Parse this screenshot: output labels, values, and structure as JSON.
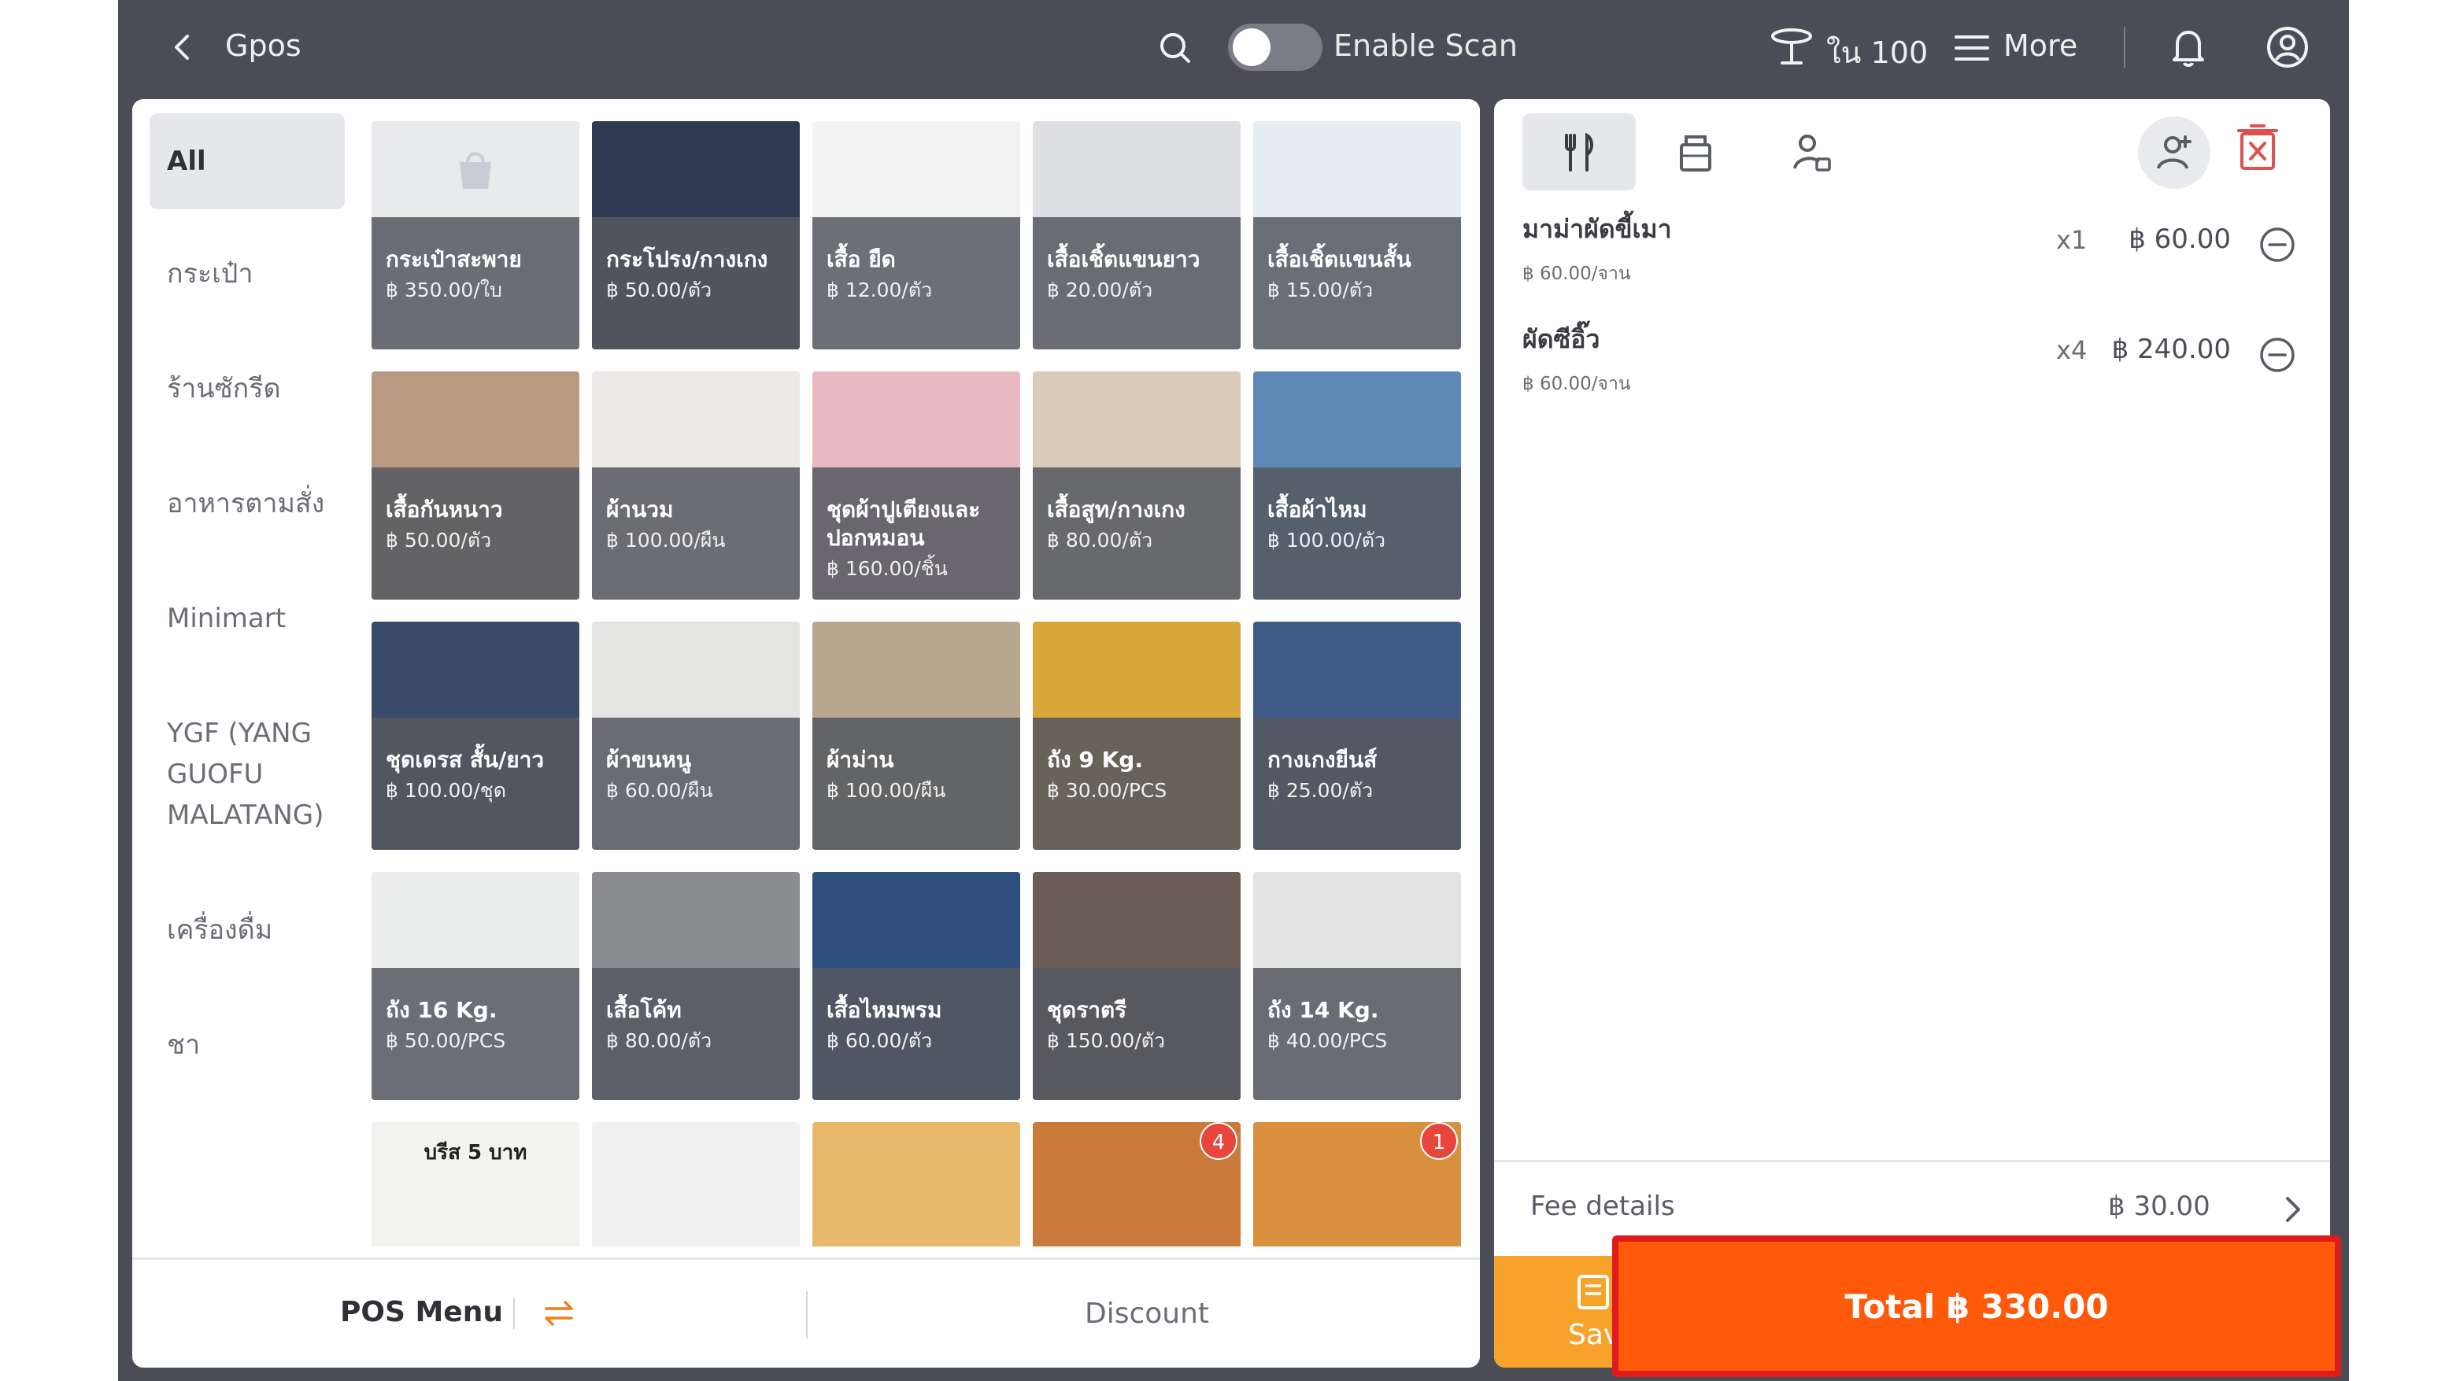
{
  "header": {
    "title": "Gpos",
    "scan_label": "Enable Scan",
    "scan_enabled": false,
    "table_label": "ใน 100",
    "more_label": "More"
  },
  "categories": [
    {
      "label": "All",
      "active": true
    },
    {
      "label": "กระเป๋า"
    },
    {
      "label": "ร้านซักรีด"
    },
    {
      "label": "อาหารตามสั่ง"
    },
    {
      "label": "Minimart"
    },
    {
      "label": "YGF (YANG GUOFU MALATANG)"
    },
    {
      "label": "เครื่องดื่ม"
    },
    {
      "label": "ชา"
    }
  ],
  "products": [
    {
      "name": "กระเป๋าสะพาย",
      "price": "฿ 350.00/ใบ",
      "bg": "#e9eaec"
    },
    {
      "name": "กระโปรง/กางเกง",
      "price": "฿ 50.00/ตัว",
      "bg": "#2f3a52"
    },
    {
      "name": "เสื้อ ยืด",
      "price": "฿ 12.00/ตัว",
      "bg": "#f3f3f3"
    },
    {
      "name": "เสื้อเชิ้ตแขนยาว",
      "price": "฿ 20.00/ตัว",
      "bg": "#dedfe2"
    },
    {
      "name": "เสื้อเชิ้ตแขนสั้น",
      "price": "฿ 15.00/ตัว",
      "bg": "#e6ecf4"
    },
    {
      "name": "เสื้อกันหนาว",
      "price": "฿ 50.00/ตัว",
      "bg": "#b89a80"
    },
    {
      "name": "ผ้านวม",
      "price": "฿ 100.00/ผืน",
      "bg": "#ece9e4"
    },
    {
      "name": "ชุดผ้าปูเตียงและปอกหมอน",
      "price": "฿ 160.00/ชิ้น",
      "bg": "#e9b9c2"
    },
    {
      "name": "เสื้อสูท/กางเกง",
      "price": "฿ 80.00/ตัว",
      "bg": "#d8cbb8"
    },
    {
      "name": "เสื้อผ้าไหม",
      "price": "฿ 100.00/ตัว",
      "bg": "#5f88b6"
    },
    {
      "name": "ชุดเดรส สั้น/ยาว",
      "price": "฿ 100.00/ชุด",
      "bg": "#3a4a6a"
    },
    {
      "name": "ผ้าขนหนู",
      "price": "฿ 60.00/ผืน",
      "bg": "#e4e4e2"
    },
    {
      "name": "ผ้าม่าน",
      "price": "฿ 100.00/ผืน",
      "bg": "#b8a78f"
    },
    {
      "name": "ถัง 9 Kg.",
      "price": "฿ 30.00/PCS",
      "bg": "#d9a63a"
    },
    {
      "name": "กางเกงยีนส์",
      "price": "฿ 25.00/ตัว",
      "bg": "#3f5c88"
    },
    {
      "name": "ถัง 16 Kg.",
      "price": "฿ 50.00/PCS",
      "bg": "#eceeee"
    },
    {
      "name": "เสื้อโค้ท",
      "price": "฿ 80.00/ตัว",
      "bg": "#8a8c90"
    },
    {
      "name": "เสื้อไหมพรม",
      "price": "฿ 60.00/ตัว",
      "bg": "#2e4f7e"
    },
    {
      "name": "ชุดราตรี",
      "price": "฿ 150.00/ตัว",
      "bg": "#6b5d58"
    },
    {
      "name": "ถัง 14 Kg.",
      "price": "฿ 40.00/PCS",
      "bg": "#e3e3e3"
    },
    {
      "name": "",
      "price": "",
      "bg": "#f2f2ee",
      "top_text": "บรีส 5 บาท"
    },
    {
      "name": "",
      "price": "",
      "bg": "#f0f0f0"
    },
    {
      "name": "",
      "price": "",
      "bg": "#e8b96a"
    },
    {
      "name": "",
      "price": "",
      "bg": "#c97a3a",
      "badge": "4"
    },
    {
      "name": "",
      "price": "",
      "bg": "#d9903e",
      "badge": "1"
    }
  ],
  "bottom_left": {
    "pos_menu_label": "POS Menu",
    "discount_label": "Discount"
  },
  "order": {
    "items": [
      {
        "name": "มาม่าผัดขี้เมา",
        "unit_price": "฿ 60.00/จาน",
        "qty": "x1",
        "total": "฿ 60.00"
      },
      {
        "name": "ผัดซีอิ๊ว",
        "unit_price": "฿ 60.00/จาน",
        "qty": "x4",
        "total": "฿ 240.00"
      }
    ],
    "fee_label": "Fee details",
    "fee_value": "฿ 30.00",
    "save_label": "Sav",
    "total_label": "Total ฿ 330.00"
  },
  "colors": {
    "accent_orange": "#ff5a0a",
    "save_orange": "#f7a32b",
    "highlight_border": "#e01b1b",
    "frame_bg": "#4a4d55"
  }
}
